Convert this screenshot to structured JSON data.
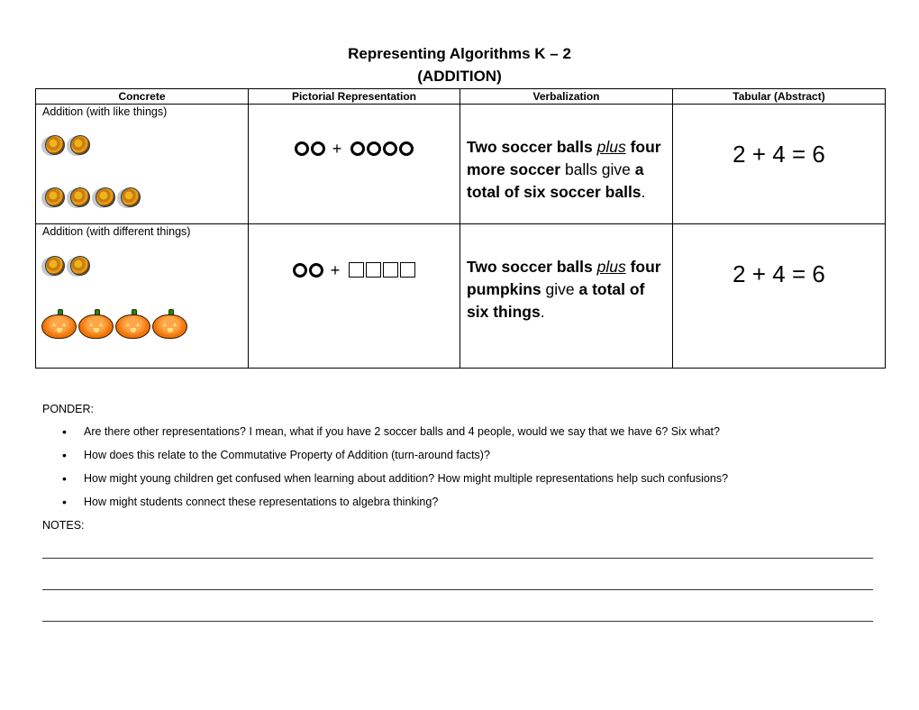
{
  "title": {
    "line1": "Representing Algorithms K – 2",
    "line2": "(ADDITION)"
  },
  "table": {
    "headers": [
      "Concrete",
      "Pictorial Representation",
      "Verbalization",
      "Tabular (Abstract)"
    ],
    "rows": [
      {
        "label": "Addition (with like things)",
        "concrete": {
          "group1": {
            "icon": "soccer-ball-icon",
            "count": 2
          },
          "group2": {
            "icon": "soccer-ball-icon",
            "count": 4
          }
        },
        "pictorial": {
          "left": {
            "shape": "circle",
            "count": 2
          },
          "operator": "+",
          "right": {
            "shape": "circle",
            "count": 4
          }
        },
        "verbalization": [
          {
            "text": "Two soccer balls ",
            "style": "bold"
          },
          {
            "text": "plus",
            "style": "italic-underline"
          },
          {
            "text": " four more soccer",
            "style": "bold"
          },
          {
            "text": " balls give ",
            "style": "normal"
          },
          {
            "text": "a total of six soccer balls",
            "style": "bold"
          },
          {
            "text": ".",
            "style": "normal"
          }
        ],
        "tabular": "2 + 4 = 6"
      },
      {
        "label": "Addition (with different things)",
        "concrete": {
          "group1": {
            "icon": "soccer-ball-icon",
            "count": 2
          },
          "group2": {
            "icon": "pumpkin-icon",
            "count": 4
          }
        },
        "pictorial": {
          "left": {
            "shape": "circle",
            "count": 2
          },
          "operator": "+",
          "right": {
            "shape": "square",
            "count": 4
          }
        },
        "verbalization": [
          {
            "text": "Two soccer balls ",
            "style": "bold"
          },
          {
            "text": "plus",
            "style": "italic-underline"
          },
          {
            "text": " four pumpkins",
            "style": "bold"
          },
          {
            "text": " give ",
            "style": "normal"
          },
          {
            "text": "a total of six things",
            "style": "bold"
          },
          {
            "text": ".",
            "style": "normal"
          }
        ],
        "tabular": "2 + 4 = 6"
      }
    ]
  },
  "ponder": {
    "heading": "PONDER:",
    "items": [
      "Are there other representations?  I mean, what if you have 2 soccer balls and 4 people, would we say that we have 6?  Six what?",
      "How does this relate to the Commutative Property of Addition (turn-around facts)?",
      "How might young children get confused when learning about addition?  How might multiple representations help such confusions?",
      "How might students connect these representations to algebra thinking?"
    ]
  },
  "notes": {
    "heading": "NOTES:",
    "blank_lines": 3
  }
}
